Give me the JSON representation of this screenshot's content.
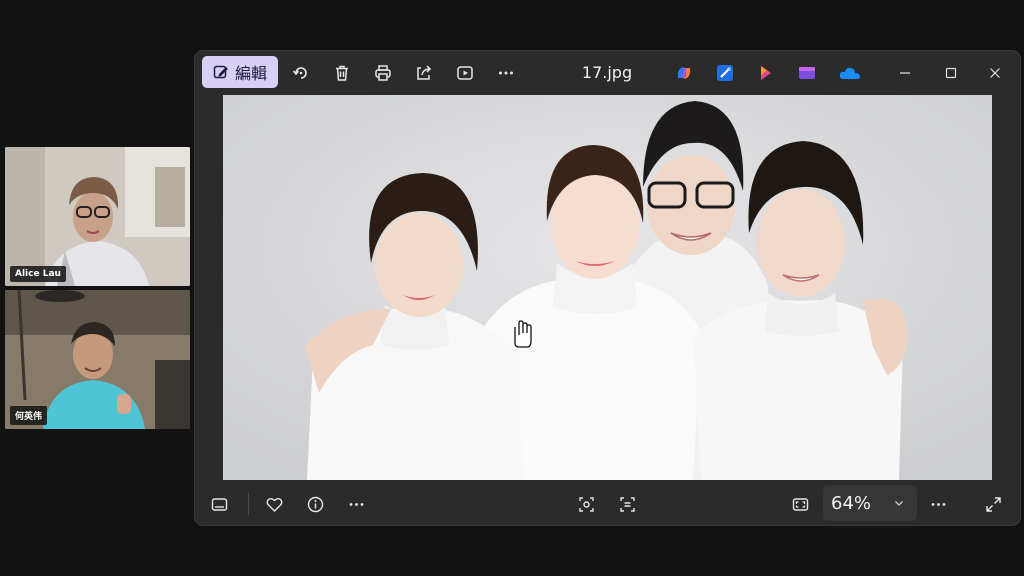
{
  "call": {
    "participants": [
      {
        "name": "Alice Lau"
      },
      {
        "name": "何英伟"
      }
    ]
  },
  "viewer": {
    "edit_label": "編輯",
    "filename": "17.jpg",
    "toolbar_icons": [
      "rotate-icon",
      "delete-icon",
      "print-icon",
      "share-icon",
      "slideshow-icon",
      "more-icon"
    ],
    "app_icons": [
      "copilot-icon",
      "designer-icon",
      "clipchamp-icon",
      "clip-icon",
      "onedrive-icon"
    ],
    "zoom": "64%",
    "colors": {
      "edit_bg": "#d7cff5",
      "window_bg": "#2b2b2b",
      "onedrive": "#1a8cff"
    }
  }
}
